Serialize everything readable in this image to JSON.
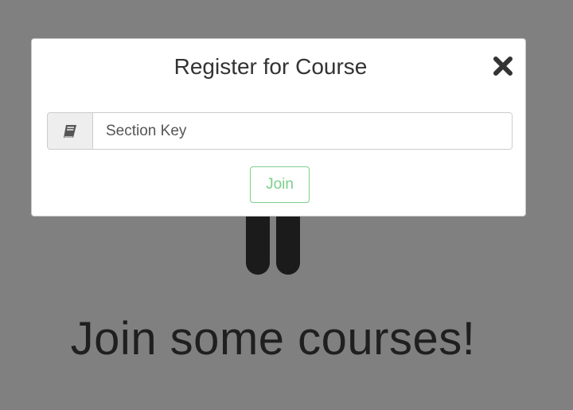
{
  "background": {
    "heading": "Join some courses!",
    "icon": "pause-icon"
  },
  "modal": {
    "title": "Register for Course",
    "close_icon": "close-icon",
    "section_key": {
      "icon": "book-icon",
      "value": "",
      "placeholder": "Section Key"
    },
    "join_label": "Join"
  },
  "colors": {
    "backdrop": "#808080",
    "join_accent": "#7ccf8b",
    "dark": "#1b1b1b"
  }
}
